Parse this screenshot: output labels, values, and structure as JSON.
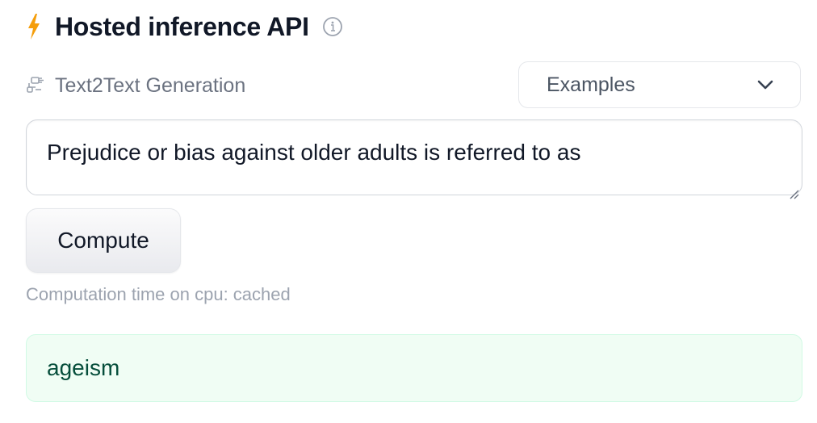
{
  "header": {
    "title": "Hosted inference API",
    "bolt_icon": "lightning-bolt-icon",
    "info_icon": "info-icon",
    "accent_color": "#f59e0b"
  },
  "task": {
    "icon": "text2text-icon",
    "label": "Text2Text Generation"
  },
  "examples_dropdown": {
    "label": "Examples",
    "icon": "chevron-down-icon"
  },
  "input": {
    "value": "Prejudice or bias against older adults is referred to as"
  },
  "compute_button": {
    "label": "Compute"
  },
  "status": {
    "computation_time": "Computation time on cpu: cached"
  },
  "output": {
    "text": "ageism",
    "background_color": "#f0fdf4",
    "text_color": "#064e3b"
  }
}
